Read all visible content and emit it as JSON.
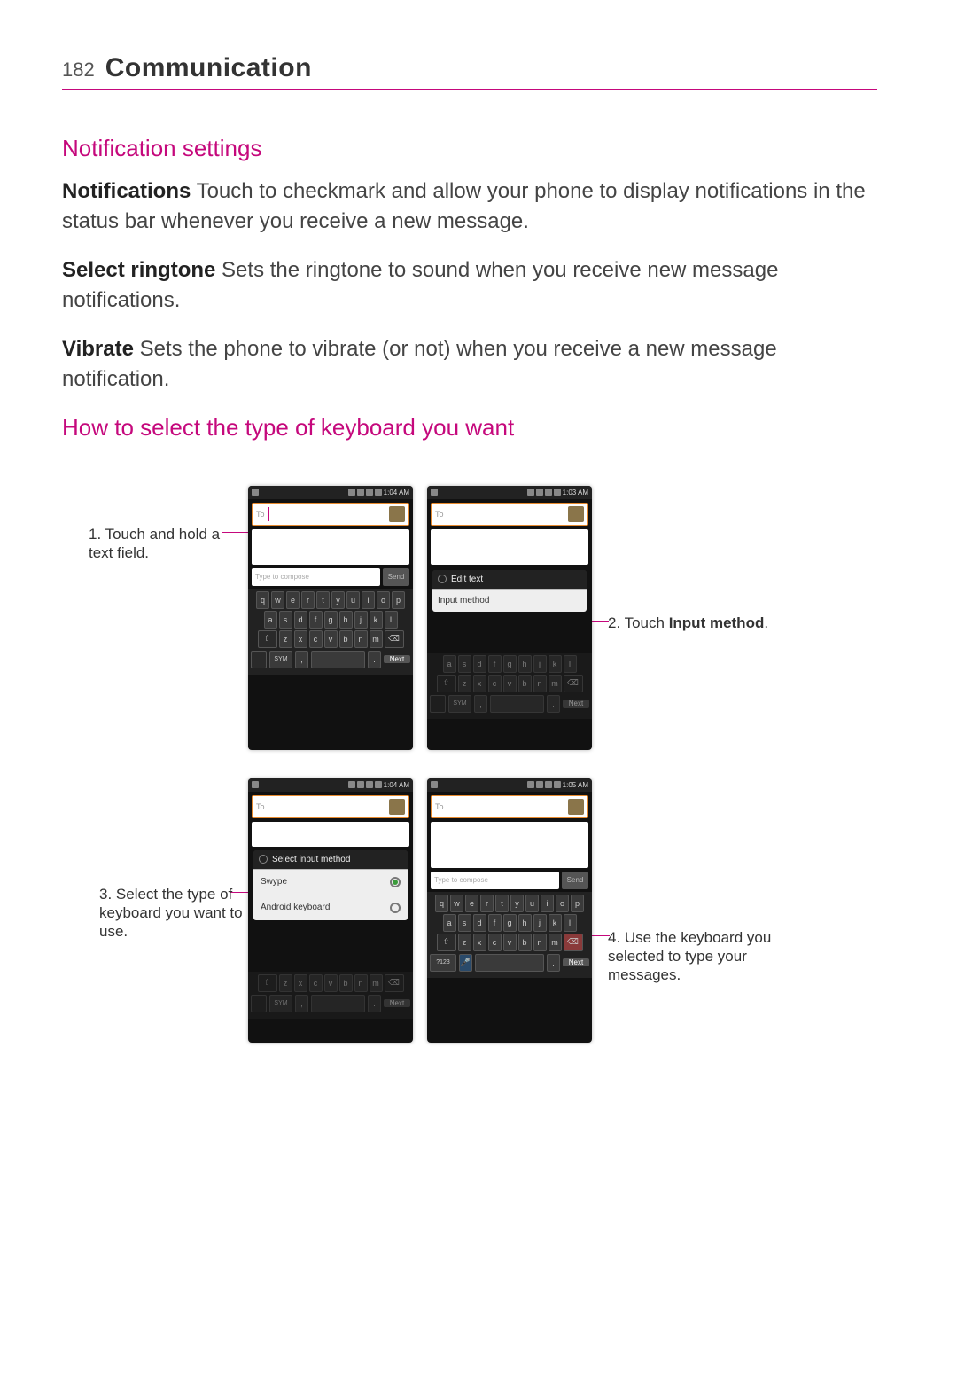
{
  "page": {
    "number": "182",
    "chapter": "Communication"
  },
  "sections": {
    "s1_title": "Notification settings",
    "s2_title": "How to select the type of keyboard you want"
  },
  "paragraphs": {
    "p1_bold": "Notifications",
    "p1_rest": "  Touch to checkmark and allow your phone to display notifications in the status bar whenever you receive a new message.",
    "p2_bold": "Select ringtone",
    "p2_rest": "  Sets the ringtone to sound when you receive new message notifications.",
    "p3_bold": "Vibrate",
    "p3_rest": "  Sets the phone to vibrate (or not) when you receive a new message notification."
  },
  "callouts": {
    "c1_num": "1. ",
    "c1_text": "Touch and hold a text field.",
    "c2_num": "2. ",
    "c2_pre": "Touch ",
    "c2_bold": "Input method",
    "c2_post": ".",
    "c3_num": "3. ",
    "c3_text": "Select the type of keyboard you want to use.",
    "c4_num": "4. ",
    "c4_text": "Use the keyboard you selected to type your messages."
  },
  "phones": {
    "times": {
      "p1": "1:04 AM",
      "p2": "1:03 AM",
      "p3": "1:04 AM",
      "p4": "1:05 AM"
    },
    "to_label": "To",
    "compose_placeholder": "Type to compose",
    "send_label": "Send",
    "next_label": "Next",
    "sym_label": "SYM",
    "num_label": "?123",
    "menu2": {
      "title": "Edit text",
      "item1": "Input method"
    },
    "menu3": {
      "title": "Select input method",
      "opt1": "Swype",
      "opt2": "Android keyboard"
    },
    "keys": {
      "r1": [
        "q",
        "w",
        "e",
        "r",
        "t",
        "y",
        "u",
        "i",
        "o",
        "p"
      ],
      "r2": [
        "a",
        "s",
        "d",
        "f",
        "g",
        "h",
        "j",
        "k",
        "l"
      ],
      "r3": [
        "z",
        "x",
        "c",
        "v",
        "b",
        "n",
        "m"
      ]
    }
  }
}
